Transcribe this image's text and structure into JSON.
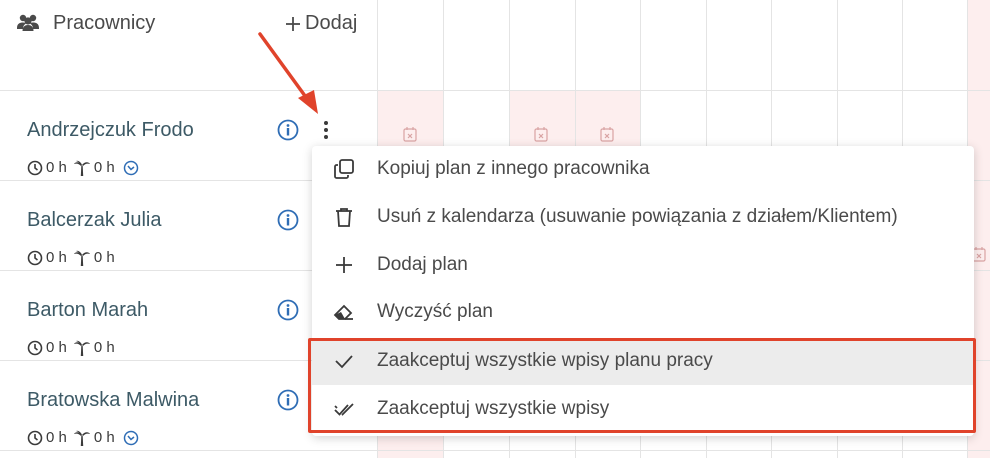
{
  "header": {
    "title": "Pracownicy",
    "add_label": "Dodaj",
    "people_icon": "people-icon",
    "add_icon": "plus-icon"
  },
  "employees": [
    {
      "name": "Andrzejczuk Frodo",
      "hours": "0 h",
      "vacation": "0 h",
      "sync": true
    },
    {
      "name": "Balcerzak Julia",
      "hours": "0 h",
      "vacation": "0 h",
      "sync": false
    },
    {
      "name": "Barton Marah",
      "hours": "0 h",
      "vacation": "0 h",
      "sync": false
    },
    {
      "name": "Bratowska Malwina",
      "hours": "0 h",
      "vacation": "0 h",
      "sync": true
    }
  ],
  "context_menu": {
    "items": [
      {
        "label": "Kopiuj plan z innego pracownika",
        "icon": "copy-icon"
      },
      {
        "label": "Usuń z kalendarza (usuwanie powiązania z działem/Klientem)",
        "icon": "trash-icon"
      },
      {
        "label": "Dodaj plan",
        "icon": "plus-icon"
      },
      {
        "label": "Wyczyść plan",
        "icon": "eraser-icon"
      },
      {
        "label": "Zaakceptuj wszystkie wpisy planu pracy",
        "icon": "check-icon",
        "highlighted": true
      },
      {
        "label": "Zaakceptuj wszystkie wpisy",
        "icon": "double-check-icon"
      }
    ]
  },
  "colors": {
    "accent": "#2f6db5",
    "annotation": "#e0432b",
    "weekend_cell": "#fdeeee",
    "name_text": "#3d5a66"
  }
}
